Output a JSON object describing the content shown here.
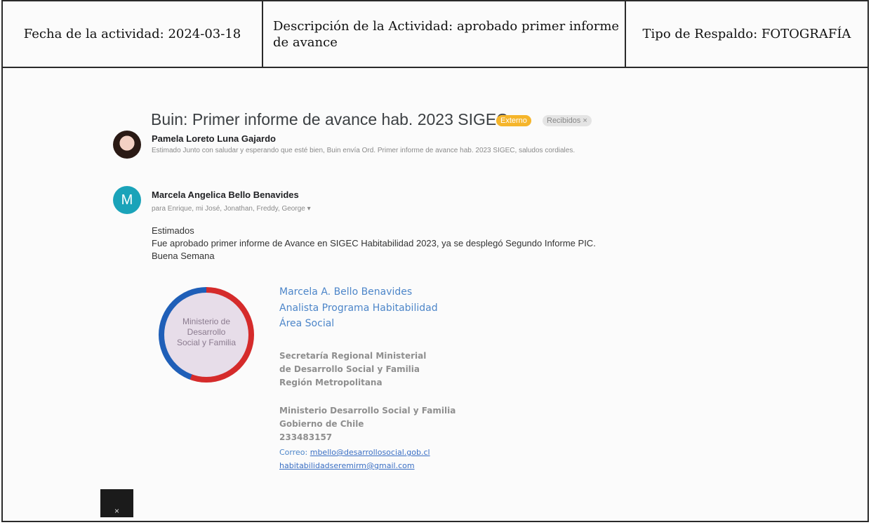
{
  "header": {
    "date_label": "Fecha de la actividad: 2024-03-18",
    "description_label": "Descripción de la Actividad: aprobado primer informe de avance",
    "support_label": "Tipo de Respaldo: FOTOGRAFÍA"
  },
  "email": {
    "subject": "Buin: Primer informe de avance hab. 2023 SIGEC",
    "tags": [
      "Externo",
      "Recibidos ×"
    ],
    "messages": [
      {
        "sender": "Pamela Loreto Luna Gajardo",
        "snippet": "Estimado Junto con saludar y esperando que esté bien, Buin envía Ord. Primer informe de avance hab. 2023 SIGEC, saludos cordiales."
      },
      {
        "avatar_letter": "M",
        "sender": "Marcela Angelica Bello Benavides",
        "recipients": "para Enrique, mi José, Jonathan, Freddy, George ▾",
        "body_lines": [
          "Estimados",
          "Fue aprobado primer informe de Avance en SIGEC Habitabilidad 2023, ya se desplegó Segundo Informe  PIC.",
          "Buena Semana"
        ]
      }
    ]
  },
  "signature": {
    "logo_text": "Ministerio de Desarrollo Social y Familia",
    "name": "Marcela A. Bello Benavides",
    "role": "Analista Programa Habitabilidad",
    "area": "Área Social",
    "org_lines": [
      "Secretaría Regional Ministerial",
      "de Desarrollo Social y Familia",
      "Región Metropolitana"
    ],
    "ministry_lines": [
      "Ministerio Desarrollo Social y Familia",
      "Gobierno de Chile",
      "233483157"
    ],
    "email_label": "Correo:",
    "email": "mbello@desarrollosocial.gob.cl",
    "email2": "habitabilidadseremirm@gmail.com"
  },
  "close_button": "×",
  "colors": {
    "accent_blue": "#4d86c9",
    "external_tag": "#f5b52b",
    "avatar_teal": "#1aa3b9"
  }
}
